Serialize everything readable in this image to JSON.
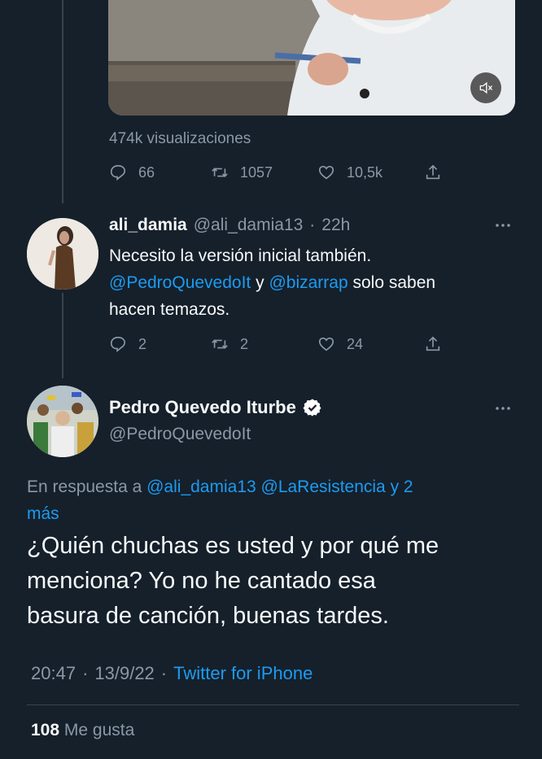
{
  "video": {
    "views": "474k visualizaciones"
  },
  "tweet1_actions": {
    "replies": "66",
    "retweets": "1057",
    "likes": "10,5k"
  },
  "reply": {
    "name": "ali_damia",
    "handle": "@ali_damia13",
    "sep": "·",
    "time": "22h",
    "line1": "Necesito la versión inicial también.",
    "mention1": "@PedroQuevedoIt",
    "conj": "y",
    "mention2": "@bizarrap",
    "line2_rest": "solo saben",
    "line3": "hacen temazos.",
    "replies": "2",
    "retweets": "2",
    "likes": "24"
  },
  "main": {
    "name": "Pedro Quevedo Iturbe",
    "handle": "@PedroQuevedoIt",
    "in_reply_prefix": "En respuesta a",
    "in_reply_mentions": "@ali_damia13 @LaResistencia y 2",
    "in_reply_more": "más",
    "text_line1": "¿Quién chuchas es usted y por qué me",
    "text_line2": "menciona? Yo no he cantado esa",
    "text_line3": "basura de canción, buenas tardes.",
    "time": "20:47",
    "dot1": "·",
    "date": "13/9/22",
    "dot2": "·",
    "client": "Twitter for iPhone",
    "likes_count": "108",
    "likes_label": "Me gusta"
  },
  "icons": {
    "reply": "reply-icon",
    "retweet": "retweet-icon",
    "like": "heart-icon",
    "share": "share-icon",
    "more": "more-icon",
    "verified": "verified-badge-icon",
    "mute": "mute-icon"
  },
  "colors": {
    "background": "#15202b",
    "link": "#1d9bf0",
    "muted": "#8b98a5",
    "verified": "#ffffff"
  }
}
